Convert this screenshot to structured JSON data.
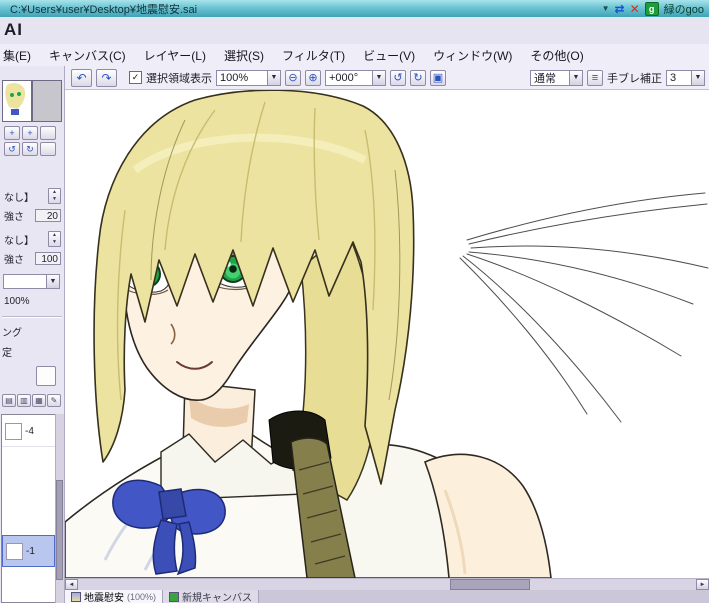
{
  "title_bar": {
    "path": "C:¥Users¥user¥Desktop¥地震慰安.sai",
    "goo_badge": "g",
    "goo_label": "緑のgoo"
  },
  "app_bar": {
    "logo_fragment": "AI"
  },
  "menu": {
    "items": [
      {
        "label": "集(E)"
      },
      {
        "label": "キャンバス(C)"
      },
      {
        "label": "レイヤー(L)"
      },
      {
        "label": "選択(S)"
      },
      {
        "label": "フィルタ(T)"
      },
      {
        "label": "ビュー(V)"
      },
      {
        "label": "ウィンドウ(W)"
      },
      {
        "label": "その他(O)"
      }
    ]
  },
  "toolbar": {
    "selection_toggle_label": "選択領域表示",
    "zoom_value": "100%",
    "angle_value": "+000°",
    "blend_mode_value": "通常",
    "stabilizer_label": "手ブレ補正",
    "stabilizer_value": "3"
  },
  "left_panel": {
    "preset_label_1": "なし】",
    "strength_label_1": "強さ",
    "strength_value_1": "20",
    "preset_label_2": "なし】",
    "strength_label_2": "強さ",
    "strength_value_2": "100",
    "opacity_value": "100%",
    "clipped_text_1": "ング",
    "clipped_text_2": "定",
    "layers": [
      {
        "name": "-4",
        "selected": false
      },
      {
        "name": "-1",
        "selected": true
      }
    ]
  },
  "tab_bar": {
    "tabs": [
      {
        "label": "地震慰安",
        "detail": "(100%)"
      },
      {
        "label": "新規キャンバス",
        "detail": ""
      }
    ]
  },
  "icons": {
    "caret_down": "▼",
    "refresh": "⇄",
    "close": "✕",
    "undo": "↶",
    "redo": "↷",
    "check": "✓",
    "zoom_out": "⊖",
    "zoom_in": "⊕",
    "rotate_ccw": "↺",
    "rotate_cw": "↻",
    "reset": "▣",
    "menu_btn": "≡",
    "plus": "+",
    "spin_up": "▲",
    "spin_down": "▼",
    "scroll_left": "◄",
    "scroll_right": "►",
    "grid": "▤",
    "folder": "▥",
    "sheet": "▦",
    "pencil": "✎"
  },
  "colors": {
    "titlebar_teal": "#44a9ba",
    "goo_green": "#1e9e3a",
    "close_red": "#d03022",
    "accent_blue": "#2a52c0",
    "selection_blue": "#b9c6ee",
    "hair_blonde": "#ece3a0",
    "skin": "#fdf2e2",
    "eye_green": "#1fa349",
    "ribbon_blue": "#4356c6",
    "braid_olive": "#857f4c"
  }
}
